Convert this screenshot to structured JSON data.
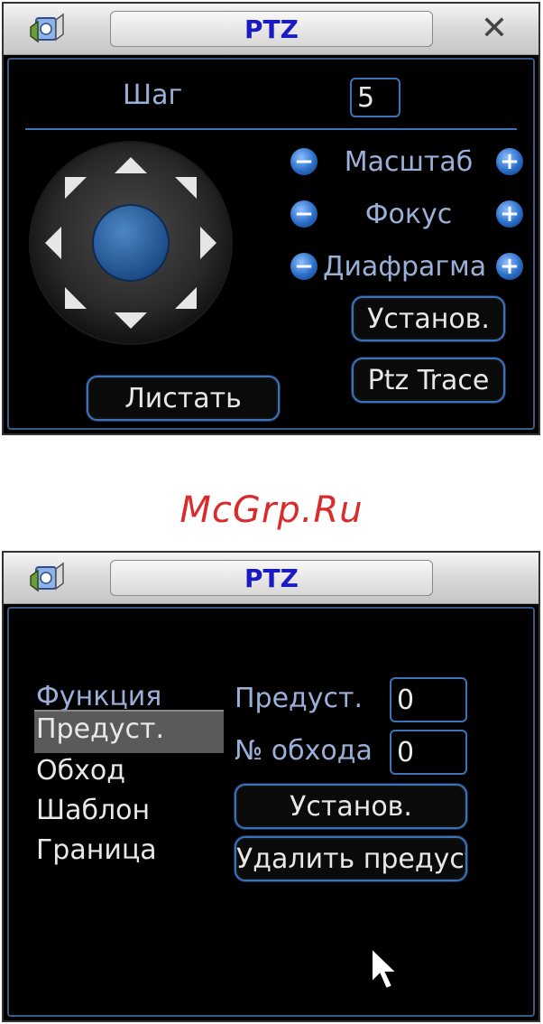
{
  "panel1": {
    "title": "PTZ",
    "close_glyph": "✕",
    "step_label": "Шаг",
    "step_value": "5",
    "zoom_label": "Масштаб",
    "focus_label": "Фокус",
    "iris_label": "Диафрагма",
    "minus_glyph": "−",
    "plus_glyph": "+",
    "setup_button": "Установ.",
    "trace_button": "Ptz Trace",
    "page_button": "Листать"
  },
  "watermark": "McGrp.Ru",
  "panel2": {
    "title": "PTZ",
    "menu_header": "Функция",
    "menu_items": [
      "Предуст.",
      "Обход",
      "Шаблон",
      "Граница"
    ],
    "preset_label": "Предуст.",
    "preset_value": "0",
    "tour_label": "№ обхода",
    "tour_value": "0",
    "setup_button": "Установ.",
    "delete_button": "Удалить предуст"
  },
  "colors": {
    "accent_blue": "#3c72b8",
    "label_blue": "#9bb0d8",
    "title_blue": "#1b1bc4",
    "watermark_red": "#d92b2b",
    "selected_row": "#5a5a5a"
  }
}
